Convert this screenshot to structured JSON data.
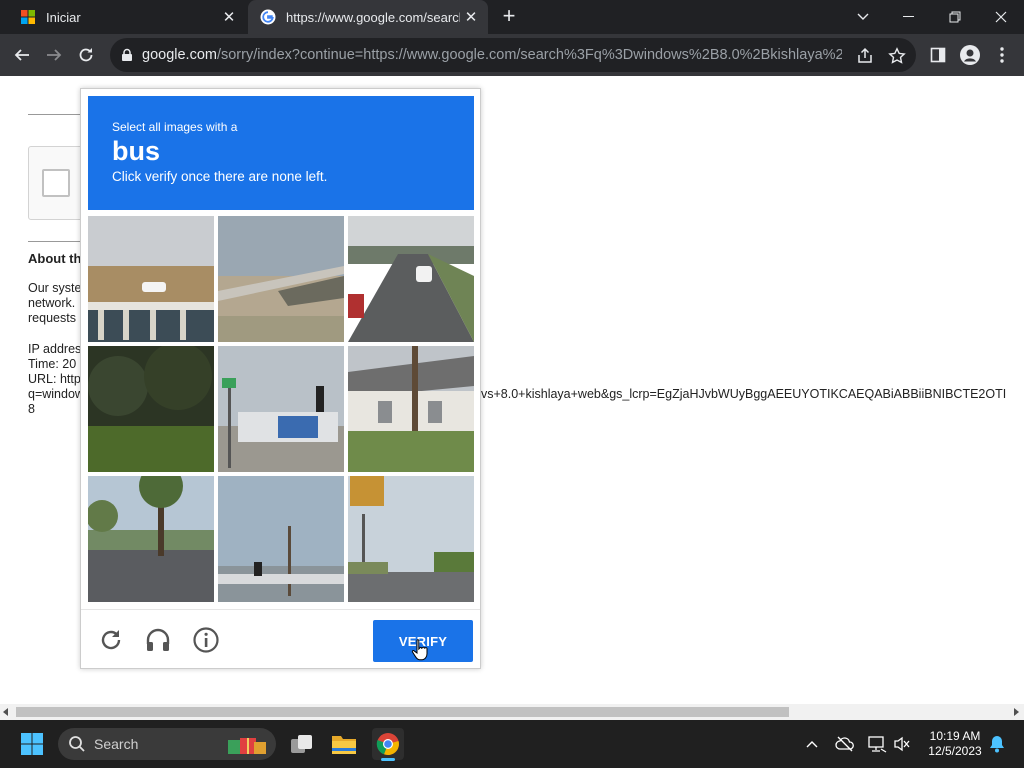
{
  "browser": {
    "tabs": [
      {
        "title": "Iniciar",
        "active": false
      },
      {
        "title": "https://www.google.com/search",
        "active": true
      }
    ],
    "url_host": "google.com",
    "url_rest": "/sorry/index?continue=https://www.google.com/search%3Fq%3Dwindows%2B8.0%2Bkishlaya%2Bw..."
  },
  "page": {
    "about_heading": "About th",
    "para1": [
      "Our syste",
      "network.",
      "requests"
    ],
    "ip_lines": [
      "IP addres",
      "Time: 20",
      "URL: http",
      "q=window",
      "8"
    ],
    "url_overflow": "vs+8.0+kishlaya+web&gs_lcrp=EgZjaHJvbWUyBggAEEUYOTIKCAEQABiABBiiBNIBCTE2OTI"
  },
  "captcha": {
    "line1": "Select all images with a",
    "target": "bus",
    "line3": "Click verify once there are none left.",
    "verify_label": "VERIFY",
    "footer_icons": [
      "reload-icon",
      "audio-headphones-icon",
      "info-icon"
    ]
  },
  "taskbar": {
    "search_label": "Search",
    "time": "10:19 AM",
    "date": "12/5/2023"
  },
  "colors": {
    "accent": "#1a73e8",
    "chrome_dark": "#202124",
    "chrome_mid": "#35363a"
  }
}
